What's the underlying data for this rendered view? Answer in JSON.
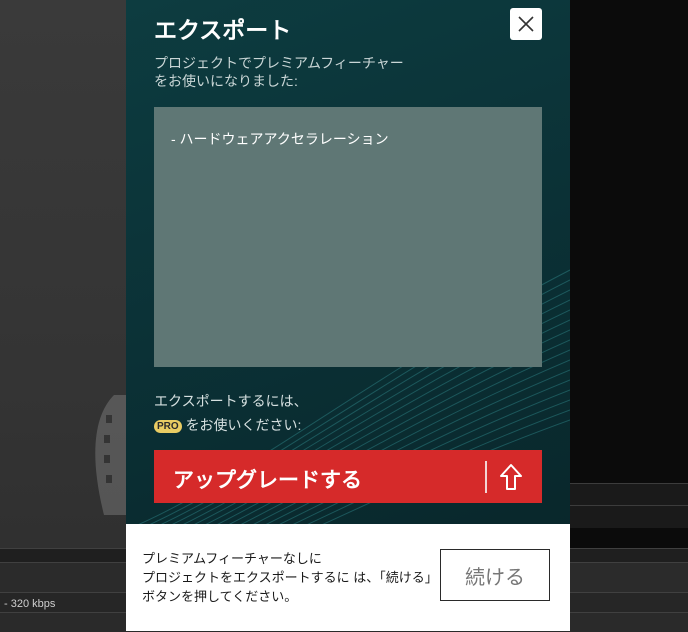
{
  "background": {
    "status_text": "- 320 kbps"
  },
  "dialog": {
    "title": "エクスポート",
    "subtitle_line1": "プロジェクトでプレミアムフィーチャー",
    "subtitle_line2": "をお使いになりました:",
    "features": [
      "- ハードウェアアクセラレーション"
    ],
    "pro_line1": "エクスポートするには、",
    "pro_badge": "PRO",
    "pro_line2": "をお使いください:",
    "upgrade_label": "アップグレードする",
    "upgrade_icon": "arrow-up-icon",
    "close_icon": "close-icon",
    "footer_line1": "プレミアムフィーチャーなしに",
    "footer_line2": "プロジェクトをエクスポートするに は、「続ける」",
    "footer_line3": "ボタンを押してください。",
    "continue_label": "続ける"
  },
  "colors": {
    "dialog_bg": "#0b3136",
    "upgrade_button": "#d62a2a",
    "pro_badge": "#e9cc63",
    "feature_box": "#5f7775"
  }
}
